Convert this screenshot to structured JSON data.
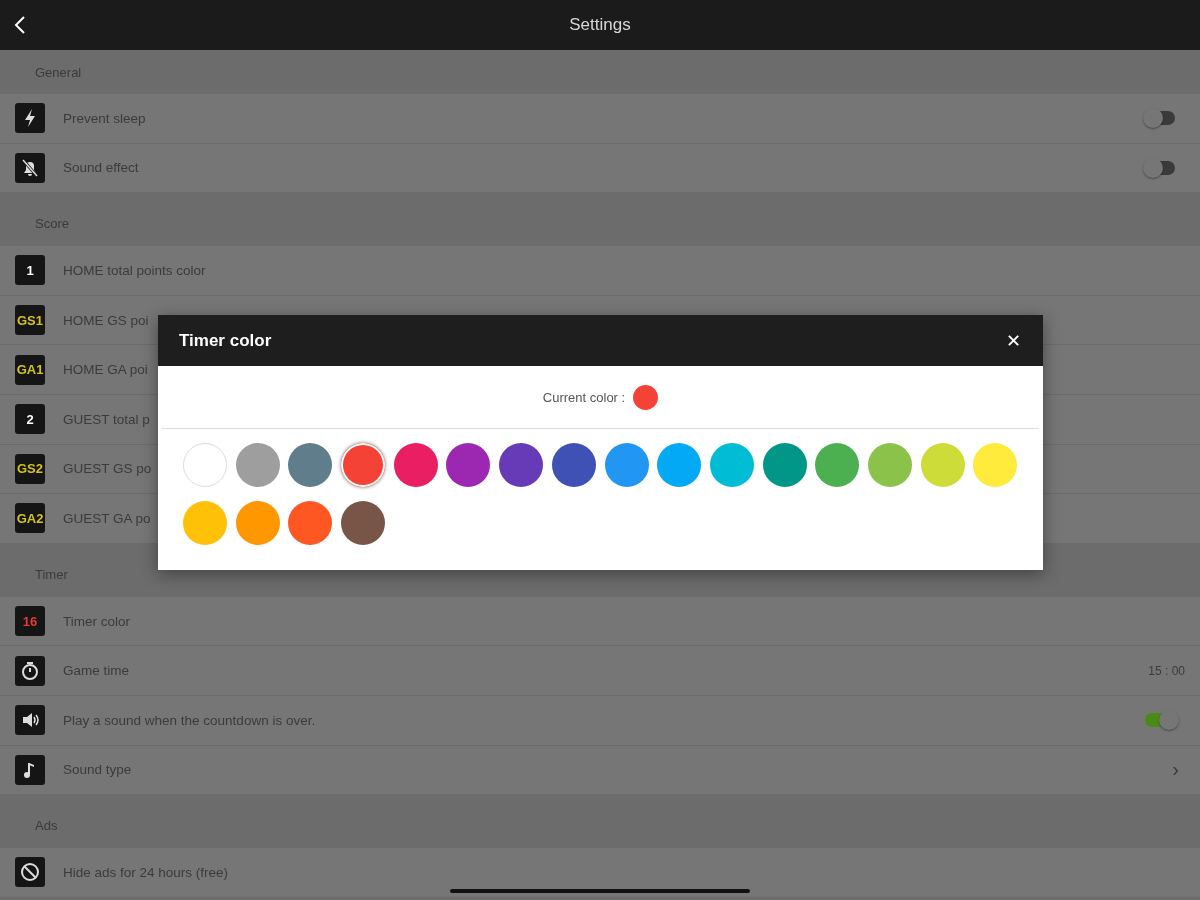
{
  "top_bar": {
    "title": "Settings"
  },
  "sections": [
    {
      "title": "General",
      "rows": [
        {
          "label": "Prevent sleep",
          "kind": "toggle",
          "on": false
        },
        {
          "label": "Sound effect",
          "kind": "toggle",
          "on": false
        }
      ]
    },
    {
      "title": "Score",
      "rows": [
        {
          "label": "HOME total points color",
          "badge": "1",
          "color": "#ffffff",
          "kind": "plain"
        },
        {
          "label": "HOME GS poi",
          "badge": "GS1",
          "color": "#d4c21a",
          "kind": "plain"
        },
        {
          "label": "HOME GA poi",
          "badge": "GA1",
          "color": "#d4c21a",
          "kind": "plain"
        },
        {
          "label": "GUEST total p",
          "badge": "2",
          "color": "#ffffff",
          "kind": "plain"
        },
        {
          "label": "GUEST GS po",
          "badge": "GS2",
          "color": "#d4c21a",
          "kind": "plain"
        },
        {
          "label": "GUEST GA po",
          "badge": "GA2",
          "color": "#d4c21a",
          "kind": "plain"
        }
      ]
    },
    {
      "title": "Timer",
      "rows": [
        {
          "label": "Timer color",
          "badge": "16",
          "color": "#e53935",
          "kind": "plain"
        },
        {
          "label": "Game time",
          "kind": "value",
          "value": "15 : 00"
        },
        {
          "label": "Play a sound when the countdown is over.",
          "kind": "toggle",
          "on": true
        },
        {
          "label": "Sound type",
          "kind": "chevron",
          "chevron": "›"
        }
      ]
    },
    {
      "title": "Ads",
      "rows": [
        {
          "label": "Hide ads for 24 hours (free)",
          "kind": "plain"
        }
      ]
    }
  ],
  "dialog": {
    "title": "Timer color",
    "close": "✕",
    "current": {
      "label": "Current color :",
      "color": "#f44336"
    },
    "swatches": [
      {
        "color": "#ffffff",
        "selected": false
      },
      {
        "color": "#9e9e9e",
        "selected": false
      },
      {
        "color": "#607d8b",
        "selected": false
      },
      {
        "color": "#f44336",
        "selected": true
      },
      {
        "color": "#e91e63",
        "selected": false
      },
      {
        "color": "#9c27b0",
        "selected": false
      },
      {
        "color": "#673ab7",
        "selected": false
      },
      {
        "color": "#3f51b5",
        "selected": false
      },
      {
        "color": "#2196f3",
        "selected": false
      },
      {
        "color": "#03a9f4",
        "selected": false
      },
      {
        "color": "#00bcd4",
        "selected": false
      },
      {
        "color": "#009688",
        "selected": false
      },
      {
        "color": "#4caf50",
        "selected": false
      },
      {
        "color": "#8bc34a",
        "selected": false
      },
      {
        "color": "#cddc39",
        "selected": false
      },
      {
        "color": "#ffeb3b",
        "selected": false
      },
      {
        "color": "#ffc107",
        "selected": false
      },
      {
        "color": "#ff9800",
        "selected": false
      },
      {
        "color": "#ff5722",
        "selected": false
      },
      {
        "color": "#795548",
        "selected": false
      }
    ]
  }
}
